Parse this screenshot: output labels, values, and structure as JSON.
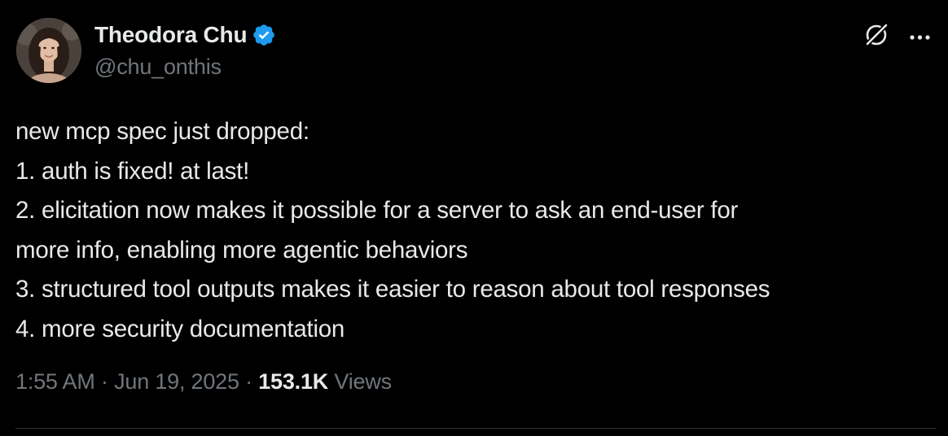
{
  "author": {
    "display_name": "Theodora Chu",
    "handle": "@chu_onthis",
    "verified": true
  },
  "tweet": {
    "lines": [
      "new mcp spec just dropped:",
      "1. auth is fixed! at last!",
      "2. elicitation now makes it possible for a server to ask an end-user for",
      "more info, enabling more agentic behaviors",
      "3. structured tool outputs makes it easier to reason about tool responses",
      "4. more security documentation"
    ]
  },
  "meta": {
    "time": "1:55 AM",
    "separator": " · ",
    "date": "Jun 19, 2025",
    "views_count": "153.1K",
    "views_label": " Views"
  },
  "icons": {
    "verified": "verified-badge-icon",
    "grok": "grok-icon",
    "more": "more-options-icon"
  },
  "colors": {
    "background": "#000000",
    "text_primary": "#e7e9ea",
    "text_secondary": "#71767b",
    "verified_blue": "#1d9bf0",
    "divider": "#2f3336"
  }
}
